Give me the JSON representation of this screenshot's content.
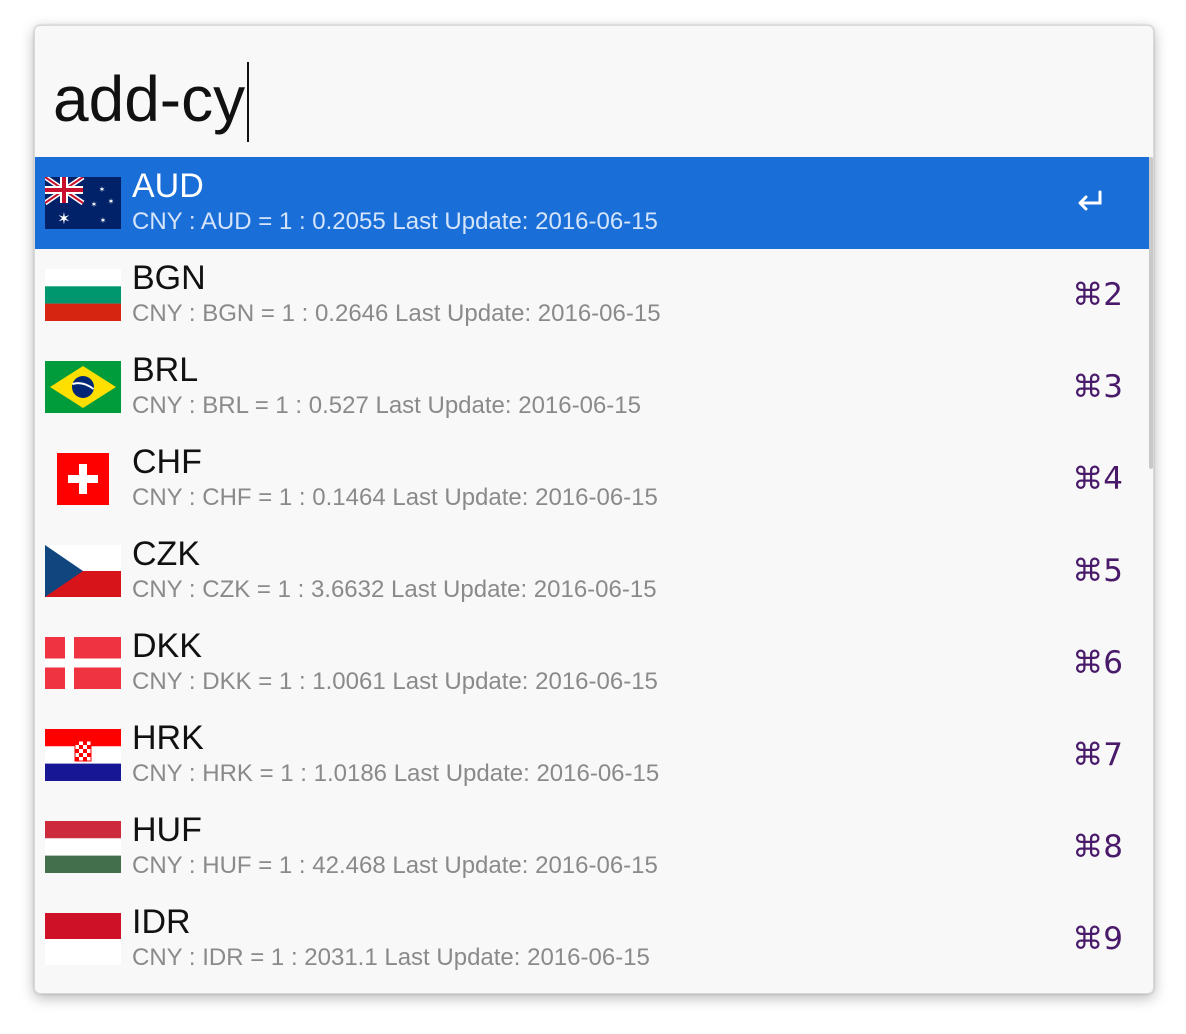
{
  "search": {
    "query": "add-cy"
  },
  "results": [
    {
      "code": "AUD",
      "detail": "CNY : AUD = 1 : 0.2055 Last Update: 2016-06-15",
      "shortcut": "",
      "icon": "australia-flag-icon"
    },
    {
      "code": "BGN",
      "detail": "CNY : BGN = 1 : 0.2646 Last Update: 2016-06-15",
      "shortcut": "⌘2",
      "icon": "bulgaria-flag-icon"
    },
    {
      "code": "BRL",
      "detail": "CNY : BRL = 1 : 0.527 Last Update: 2016-06-15",
      "shortcut": "⌘3",
      "icon": "brazil-flag-icon"
    },
    {
      "code": "CHF",
      "detail": "CNY : CHF = 1 : 0.1464 Last Update: 2016-06-15",
      "shortcut": "⌘4",
      "icon": "switzerland-flag-icon"
    },
    {
      "code": "CZK",
      "detail": "CNY : CZK = 1 : 3.6632 Last Update: 2016-06-15",
      "shortcut": "⌘5",
      "icon": "czech-flag-icon"
    },
    {
      "code": "DKK",
      "detail": "CNY : DKK = 1 : 1.0061 Last Update: 2016-06-15",
      "shortcut": "⌘6",
      "icon": "denmark-flag-icon"
    },
    {
      "code": "HRK",
      "detail": "CNY : HRK = 1 : 1.0186 Last Update: 2016-06-15",
      "shortcut": "⌘7",
      "icon": "croatia-flag-icon"
    },
    {
      "code": "HUF",
      "detail": "CNY : HUF = 1 : 42.468 Last Update: 2016-06-15",
      "shortcut": "⌘8",
      "icon": "hungary-flag-icon"
    },
    {
      "code": "IDR",
      "detail": "CNY : IDR = 1 : 2031.1 Last Update: 2016-06-15",
      "shortcut": "⌘9",
      "icon": "indonesia-flag-icon"
    }
  ],
  "selected_action_icon": "return-key-icon",
  "colors": {
    "selection": "#1a6ed8",
    "shortcut": "#4a1a6a",
    "subtitle": "#8a8a8a"
  }
}
